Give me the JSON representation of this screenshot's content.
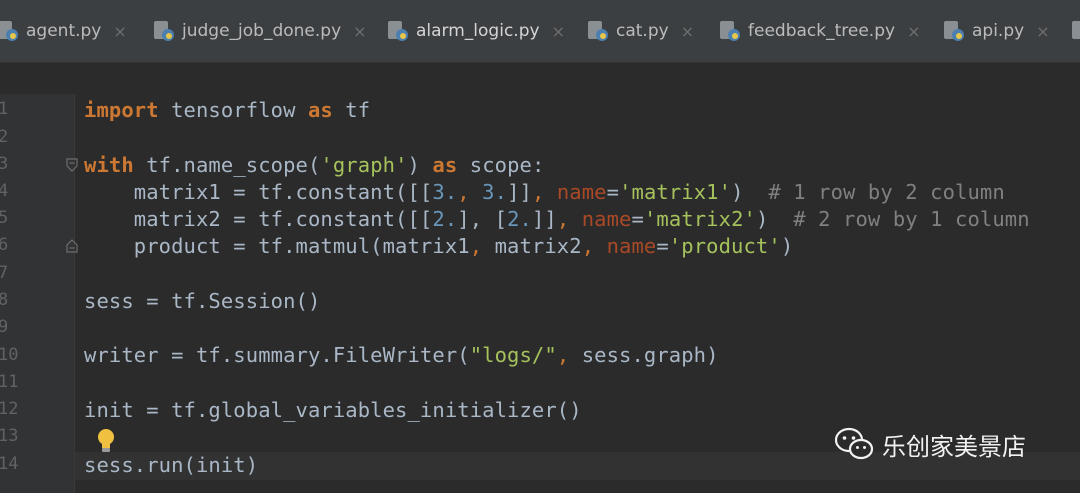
{
  "tabs": [
    {
      "label": "agent.py"
    },
    {
      "label": "judge_job_done.py"
    },
    {
      "label": "alarm_logic.py"
    },
    {
      "label": "cat.py"
    },
    {
      "label": "feedback_tree.py"
    },
    {
      "label": "api.py"
    }
  ],
  "tab_close_glyph": "×",
  "line_numbers": [
    "1",
    "2",
    "3",
    "4",
    "5",
    "6",
    "7",
    "8",
    "9",
    "10",
    "11",
    "12",
    "13",
    "14"
  ],
  "code": {
    "l1": {
      "kw1": "import",
      "t1": " tensorflow ",
      "kw2": "as",
      "t2": " tf"
    },
    "l3": {
      "kw1": "with",
      "t1": " tf.name_scope(",
      "s1": "'graph'",
      "t2": ") ",
      "kw2": "as",
      "t3": " scope:"
    },
    "l4": {
      "t1": "    matrix1 = tf.constant([[",
      "n1": "3.",
      "p1": ", ",
      "n2": "3.",
      "t2": "]]",
      "p2": ", ",
      "prm": "name",
      "t3": "=",
      "s1": "'matrix1'",
      "t4": ")  ",
      "c1": "# 1 row by 2 column"
    },
    "l5": {
      "t1": "    matrix2 = tf.constant([[",
      "n1": "2.",
      "t2": "], [",
      "n2": "2.",
      "t3": "]]",
      "p1": ", ",
      "prm": "name",
      "t4": "=",
      "s1": "'matrix2'",
      "t5": ")  ",
      "c1": "# 2 row by 1 column"
    },
    "l6": {
      "t1": "    product = tf.matmul(matrix1",
      "p1": ", ",
      "t2": "matrix2",
      "p2": ", ",
      "prm": "name",
      "t3": "=",
      "s1": "'product'",
      "t4": ")"
    },
    "l8": {
      "t1": "sess = tf.Session()"
    },
    "l10": {
      "t1": "writer = tf.summary.FileWriter(",
      "s1": "\"logs/\"",
      "p1": ", ",
      "t2": "sess.graph)"
    },
    "l12": {
      "t1": "init = tf.global_variables_initializer()"
    },
    "l14": {
      "t1": "sess.run(init)"
    }
  },
  "watermark": {
    "text": "乐创家美景店"
  },
  "colors": {
    "keyword": "#cc7832",
    "string": "#a5c25c",
    "number": "#6897bb",
    "param": "#aa4926",
    "comment": "#808080",
    "text": "#a9b7c6",
    "background": "#2b2b2b"
  }
}
